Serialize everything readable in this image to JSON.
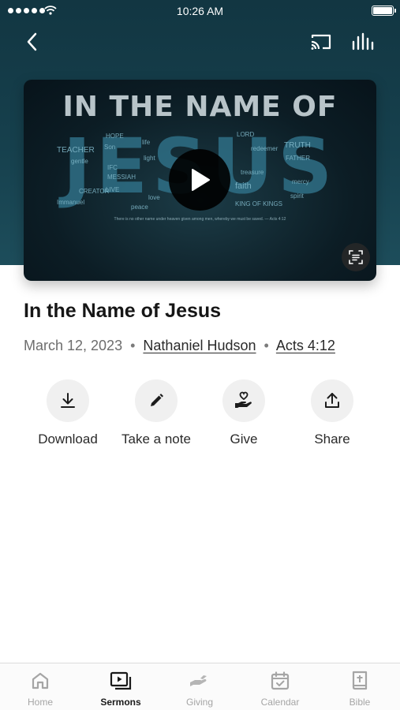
{
  "status_bar": {
    "time": "10:26 AM"
  },
  "nav": {
    "back_icon": "chevron-left-icon",
    "cast_icon": "cast-icon",
    "audio_icon": "audio-bars-icon"
  },
  "artwork": {
    "headline": "IN THE NAME OF",
    "big_word": "JESUS",
    "words": [
      "HOPE",
      "TEACHER",
      "Son",
      "gentle",
      "IFC",
      "MESSIAH",
      "LORD",
      "redeemer",
      "TRUTH",
      "FATHER",
      "faith",
      "KING OF KINGS",
      "treasure",
      "spirit",
      "mercy",
      "life",
      "light",
      "LIVE",
      "CREATOR",
      "love",
      "Immanuel",
      "peace"
    ],
    "verse": "There is no other name under heaven given among men, whereby we must be saved. — Acts 4:12",
    "play_icon": "play-icon",
    "transcript_icon": "transcript-icon"
  },
  "sermon": {
    "title": "In the Name of Jesus",
    "date": "March 12, 2023",
    "separator": "•",
    "speaker": "Nathaniel Hudson",
    "scripture": "Acts 4:12"
  },
  "actions": [
    {
      "label": "Download",
      "icon": "download-icon"
    },
    {
      "label": "Take a note",
      "icon": "pencil-icon"
    },
    {
      "label": "Give",
      "icon": "heart-hand-icon"
    },
    {
      "label": "Share",
      "icon": "share-icon"
    }
  ],
  "tabs": [
    {
      "label": "Home",
      "icon": "home-icon",
      "active": false
    },
    {
      "label": "Sermons",
      "icon": "sermons-icon",
      "active": true
    },
    {
      "label": "Giving",
      "icon": "giving-icon",
      "active": false
    },
    {
      "label": "Calendar",
      "icon": "calendar-icon",
      "active": false
    },
    {
      "label": "Bible",
      "icon": "bible-icon",
      "active": false
    }
  ],
  "colors": {
    "header_bg": "#16404d",
    "active_tab": "#1a1a1a",
    "inactive_tab": "#a5a5a5",
    "action_circle": "#f0f0f0"
  }
}
